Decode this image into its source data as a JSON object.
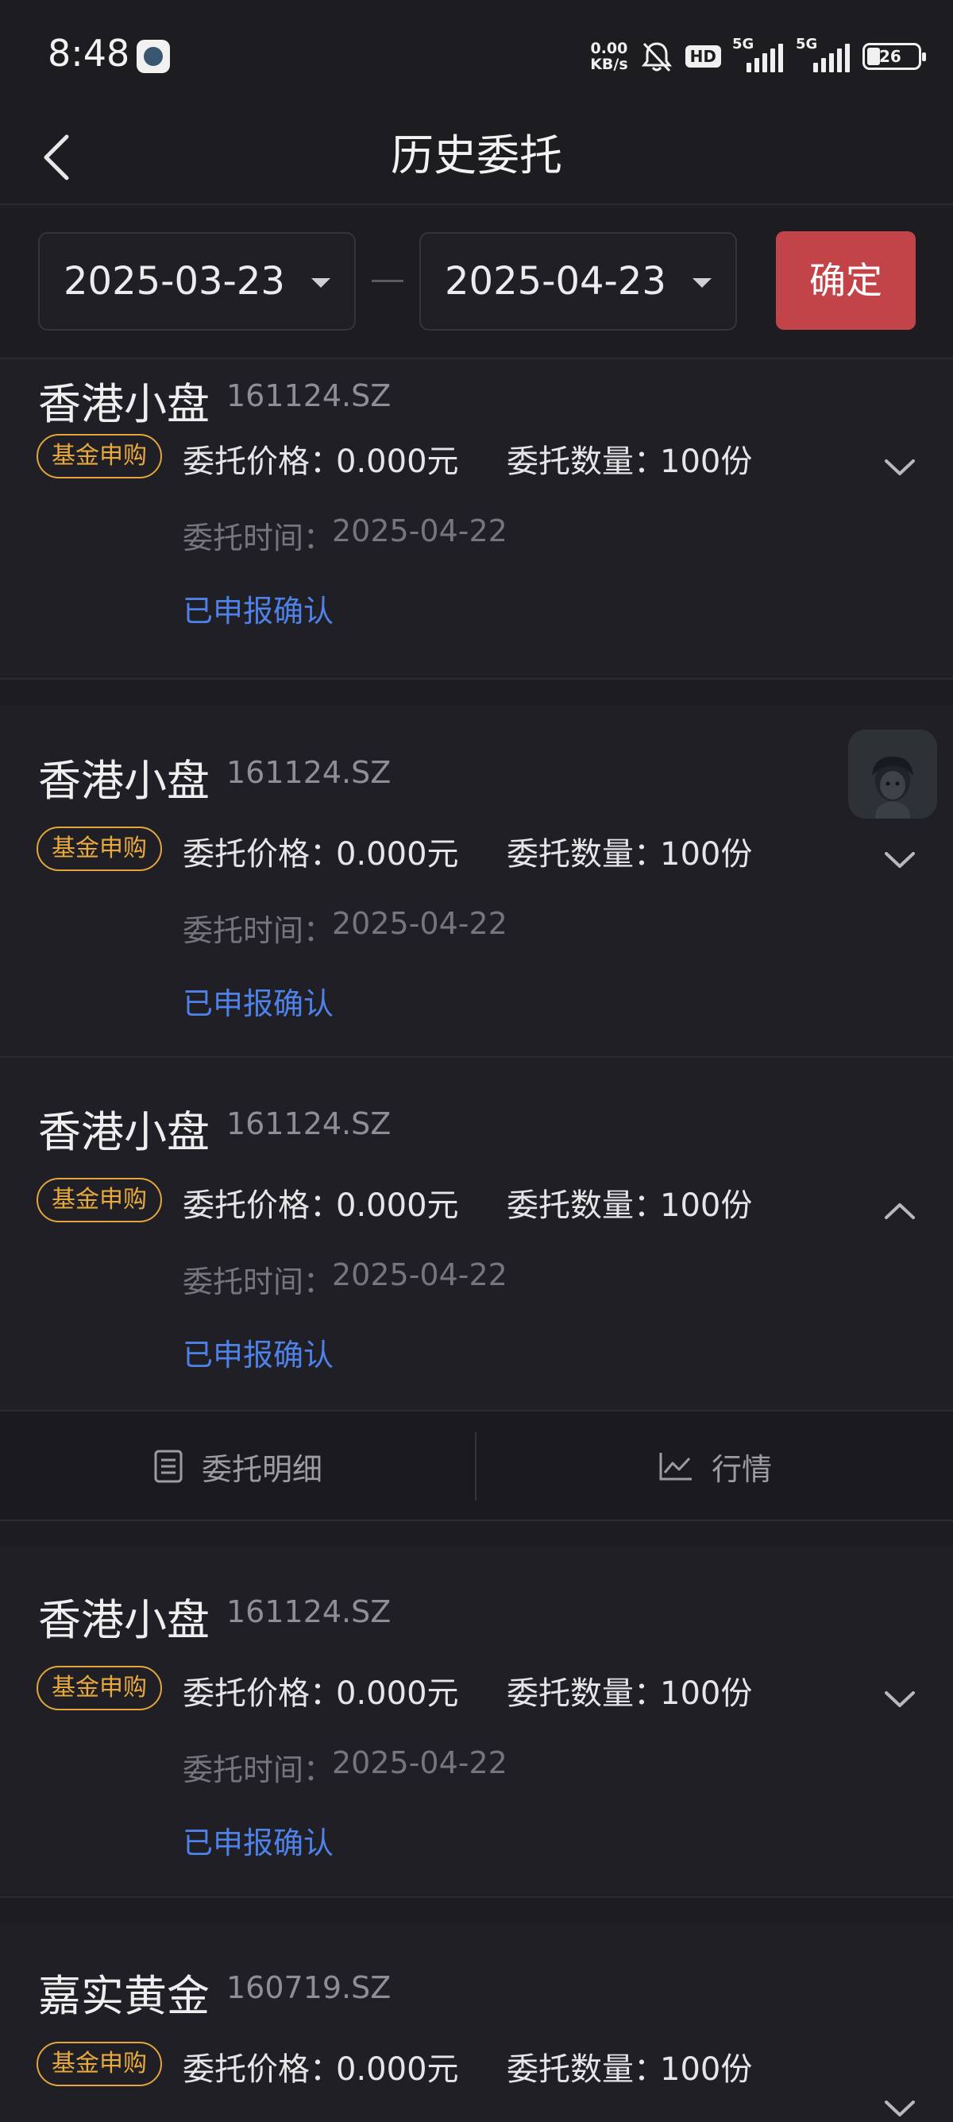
{
  "status_bar": {
    "time": "8:48",
    "net_speed_value": "0.00",
    "net_speed_unit": "KB/s",
    "hd_label": "HD",
    "signal1_label": "5G",
    "signal2_label": "5G",
    "battery": "26"
  },
  "header": {
    "title": "历史委托",
    "back_icon": "chevron-left-icon"
  },
  "filter": {
    "start_date": "2025-03-23",
    "end_date": "2025-04-23",
    "separator": "—",
    "confirm_label": "确定"
  },
  "orders": [
    {
      "name": "香港小盘",
      "code": "161124.SZ",
      "tag": "基金申购",
      "price_label": "委托价格：",
      "price": "0.000元",
      "qty_label": "委托数量：",
      "qty": "100份",
      "time_label": "委托时间：",
      "time": "2025-04-22",
      "status": "已申报确认",
      "expanded": false
    },
    {
      "name": "香港小盘",
      "code": "161124.SZ",
      "tag": "基金申购",
      "price_label": "委托价格：",
      "price": "0.000元",
      "qty_label": "委托数量：",
      "qty": "100份",
      "time_label": "委托时间：",
      "time": "2025-04-22",
      "status": "已申报确认",
      "expanded": false
    },
    {
      "name": "香港小盘",
      "code": "161124.SZ",
      "tag": "基金申购",
      "price_label": "委托价格：",
      "price": "0.000元",
      "qty_label": "委托数量：",
      "qty": "100份",
      "time_label": "委托时间：",
      "time": "2025-04-22",
      "status": "已申报确认",
      "expanded": true
    },
    {
      "name": "香港小盘",
      "code": "161124.SZ",
      "tag": "基金申购",
      "price_label": "委托价格：",
      "price": "0.000元",
      "qty_label": "委托数量：",
      "qty": "100份",
      "time_label": "委托时间：",
      "time": "2025-04-22",
      "status": "已申报确认",
      "expanded": false
    },
    {
      "name": "嘉实黄金",
      "code": "160719.SZ",
      "tag": "基金申购",
      "price_label": "委托价格：",
      "price": "0.000元",
      "qty_label": "委托数量：",
      "qty": "100份",
      "expanded": false
    }
  ],
  "expanded_actions": {
    "detail_label": "委托明细",
    "detail_icon": "list-doc-icon",
    "market_label": "行情",
    "market_icon": "line-chart-icon"
  },
  "colors": {
    "background": "#1c1c21",
    "card": "#1f1f25",
    "accent_button": "#c24448",
    "tag_orange": "#e8aa3f",
    "status_blue": "#4f82e8"
  }
}
